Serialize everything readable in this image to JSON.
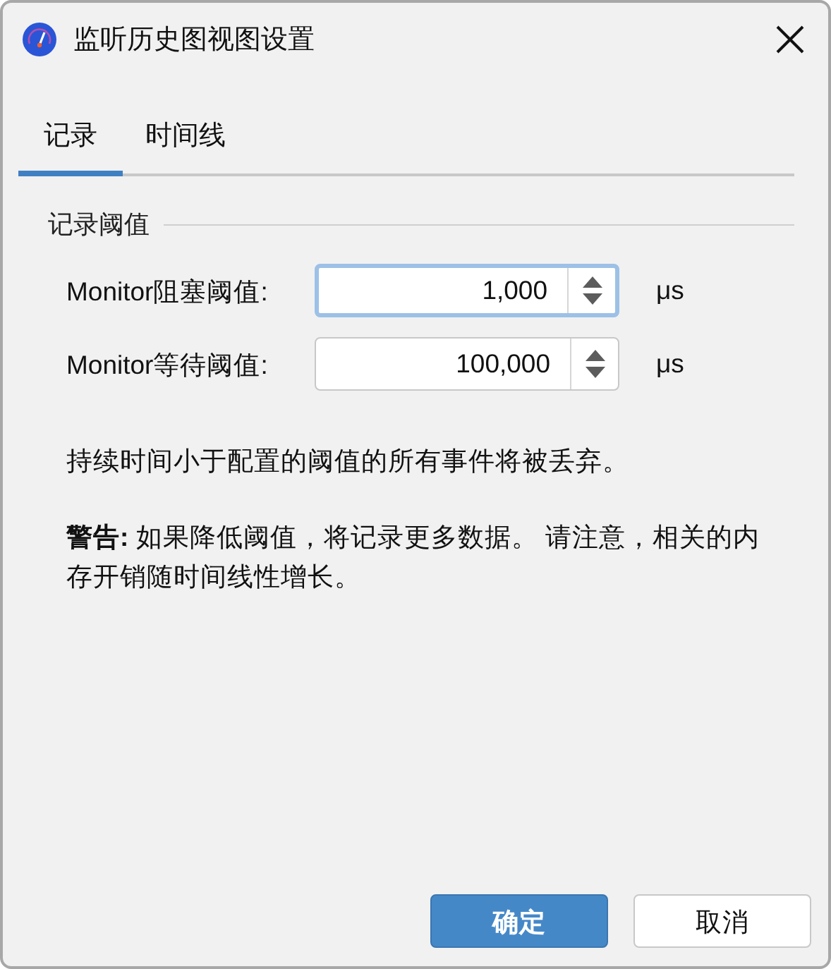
{
  "window": {
    "title": "监听历史图视图设置"
  },
  "tabs": [
    {
      "label": "记录",
      "selected": true
    },
    {
      "label": "时间线",
      "selected": false
    }
  ],
  "group": {
    "title": "记录阈值"
  },
  "fields": [
    {
      "label": "Monitor阻塞阈值:",
      "value": "1,000",
      "unit": "μs",
      "focused": true
    },
    {
      "label": "Monitor等待阈值:",
      "value": "100,000",
      "unit": "μs",
      "focused": false
    }
  ],
  "notes": [
    "持续时间小于配置的阈值的所有事件将被丢弃。",
    "**警告:** 如果降低阈值，将记录更多数据。 请注意，相关的内存开销随时间线性增长。"
  ],
  "buttons": [
    {
      "label": "确定",
      "kind": "primary"
    },
    {
      "label": "取消",
      "kind": "secondary"
    }
  ]
}
